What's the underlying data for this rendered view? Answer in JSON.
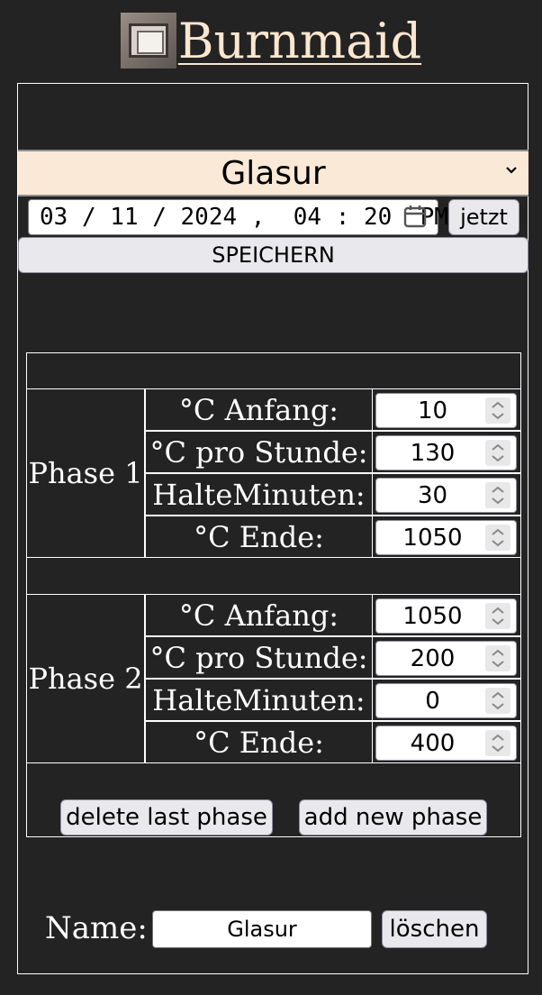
{
  "app": {
    "title": "Burnmaid"
  },
  "program": {
    "selected": "Glasur",
    "datetime": "03 / 11 / 2024 ,  04 : 20  PM",
    "now_label": "jetzt",
    "save_label": "SPEICHERN"
  },
  "phases": [
    {
      "label": "Phase 1",
      "rows": [
        {
          "label": "°C Anfang:",
          "value": "10"
        },
        {
          "label": "°C pro Stunde:",
          "value": "130"
        },
        {
          "label": "HalteMinuten:",
          "value": "30"
        },
        {
          "label": "°C Ende:",
          "value": "1050"
        }
      ]
    },
    {
      "label": "Phase 2",
      "rows": [
        {
          "label": "°C Anfang:",
          "value": "1050"
        },
        {
          "label": "°C pro Stunde:",
          "value": "200"
        },
        {
          "label": "HalteMinuten:",
          "value": "0"
        },
        {
          "label": "°C Ende:",
          "value": "400"
        }
      ]
    }
  ],
  "actions": {
    "delete_phase": "delete last phase",
    "add_phase": "add new phase"
  },
  "name_section": {
    "label": "Name:",
    "value": "Glasur",
    "delete_label": "löschen"
  },
  "icons": [
    "oven-logo-icon",
    "chevron-down-icon",
    "calendar-icon",
    "spinner-arrows-icon"
  ]
}
